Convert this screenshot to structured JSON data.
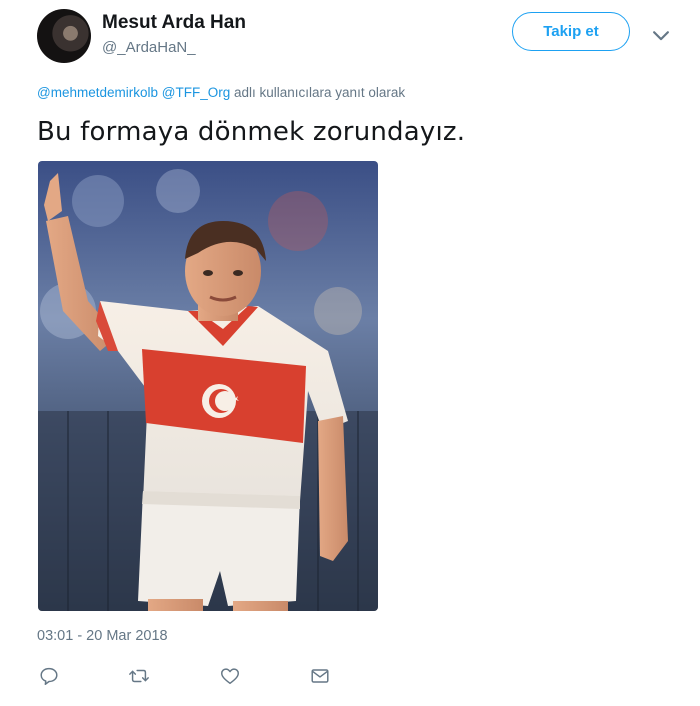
{
  "tweet": {
    "author": {
      "display_name": "Mesut Arda Han",
      "handle": "@_ArdaHaN_"
    },
    "follow_label": "Takip et",
    "menu_icon": "chevron-down-icon",
    "reply_context": {
      "mentions": [
        "@mehmetdemirkolb",
        "@TFF_Org"
      ],
      "suffix": "adlı kullanıcılara yanıt olarak"
    },
    "text": "Bu formaya dönmek zorundayız.",
    "timestamp": "03:01 - 20 Mar 2018",
    "actions": [
      "reply-icon",
      "retweet-icon",
      "like-icon",
      "direct-message-icon"
    ]
  },
  "colors": {
    "brand": "#1da1f2",
    "mention": "#1b95e0",
    "muted": "#657786",
    "text": "#14171a"
  }
}
